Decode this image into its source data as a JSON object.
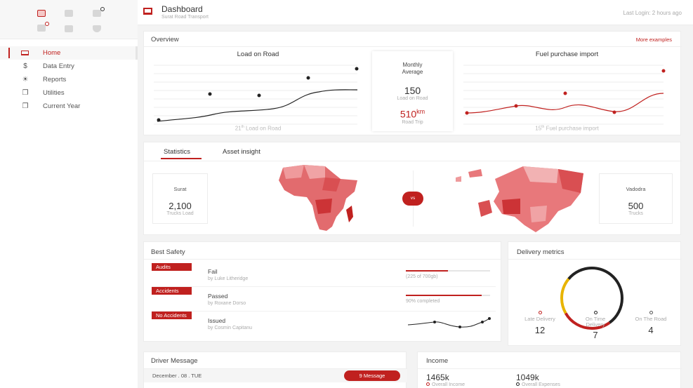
{
  "colors": {
    "accent": "#c0211f",
    "yellow": "#e8b400",
    "ring_dark": "#222222"
  },
  "header": {
    "title": "Dashboard",
    "subtitle": "Surat Road Transport",
    "last_login": "Last Login: 2 hours ago",
    "icon": "laptop-icon"
  },
  "sidebar": {
    "top_icons": [
      "calendar-icon",
      "image-icon",
      "mail-notification-icon",
      "check-notification-icon",
      "camera-icon",
      "shield-icon"
    ],
    "items": [
      {
        "label": "Home",
        "icon": "laptop-icon",
        "active": true
      },
      {
        "label": "Data Entry",
        "icon": "dollar-icon"
      },
      {
        "label": "Reports",
        "icon": "sun-icon"
      },
      {
        "label": "Utilities",
        "icon": "copy-icon"
      },
      {
        "label": "Current Year",
        "icon": "copy-icon"
      }
    ]
  },
  "overview": {
    "title": "Overview",
    "more_link": "More examples",
    "load_chart": {
      "title": "Load on Road",
      "caption_num": "21",
      "caption_sup": "th",
      "caption_text": " Load on Road"
    },
    "monthly": {
      "label_line1": "Monthly",
      "label_line2": "Average",
      "value1": "150",
      "sub1": "Load on Road",
      "value2": "510",
      "value2_sup": "km",
      "sub2": "Road Trip"
    },
    "fuel_chart": {
      "title": "Fuel purchase import",
      "caption_num": "15",
      "caption_sup": "th",
      "caption_text": " Fuel purchase import"
    }
  },
  "tabs": [
    {
      "label": "Statistics",
      "active": true
    },
    {
      "label": "Asset insight",
      "active": false
    }
  ],
  "stats": {
    "left": {
      "city": "Surat",
      "value": "2,100",
      "unit": "Trucks Load"
    },
    "vs": "vs",
    "right": {
      "city": "Vadodra",
      "value": "500",
      "unit": "Trucks"
    }
  },
  "best_safety": {
    "title": "Best Safety",
    "rows": [
      {
        "tag": "Audits",
        "title": "Fail",
        "by": "by Luke Litheridge",
        "metric": "(225 of 700gb)",
        "progress": 0.5
      },
      {
        "tag": "Accidents",
        "title": "Passed",
        "by": "by Roxane Dorso",
        "metric": "90% completed",
        "progress": 0.9
      },
      {
        "tag": "No Accidents",
        "title": "Issued",
        "by": "by Cosmin Capitanu",
        "metric": "",
        "progress": null
      }
    ]
  },
  "delivery": {
    "title": "Delivery metrics",
    "metrics": [
      {
        "label": "Late Delivery",
        "value": "12"
      },
      {
        "label": "On Time Delivery",
        "value": "7"
      },
      {
        "label": "On The Road",
        "value": "4"
      }
    ]
  },
  "driver_message": {
    "title": "Driver Message",
    "date": "December . 08 . TUE",
    "badge": "9 Message"
  },
  "income": {
    "title": "Income",
    "items": [
      {
        "value": "1465k",
        "label": "Overall Income"
      },
      {
        "value": "1049k",
        "label": "Overall Expenses"
      }
    ]
  }
}
